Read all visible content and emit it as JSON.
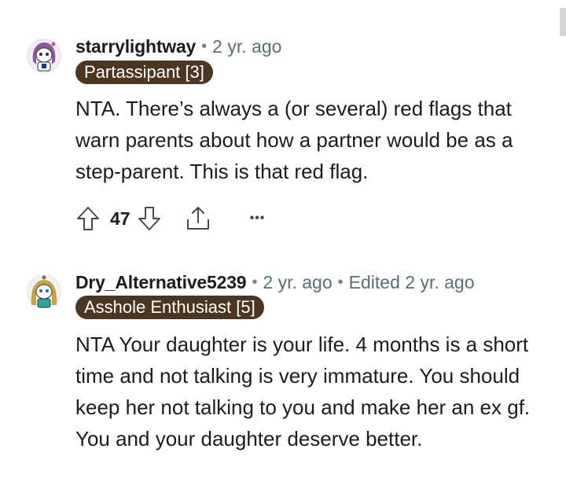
{
  "comments": [
    {
      "username": "starrylightway",
      "age": "2 yr. ago",
      "edited": "",
      "flair": "Partassipant [3]",
      "body": "NTA. There’s always a (or several) red flags that warn parents about how a partner would be as a step-parent. This is that red flag.",
      "score": "47",
      "avatar_icon": "snoo-avatar-icon"
    },
    {
      "username": "Dry_Alternative5239",
      "age": "2 yr. ago",
      "edited": "Edited 2 yr. ago",
      "flair": "Asshole Enthusiast [5]",
      "body": "NTA Your daughter is your life. 4 months is a short time and not talking is very immature. You should keep her not talking to you and make her an ex gf. You and your daughter deserve better.",
      "avatar_icon": "snoo-avatar-icon"
    }
  ],
  "separator": "•",
  "more_label": "•••",
  "colors": {
    "flair_bg": "#4a3621",
    "meta_gray": "#576f76",
    "text": "#1c1c1c"
  },
  "icons": [
    "upvote-icon",
    "downvote-icon",
    "share-icon",
    "more-options-icon"
  ]
}
